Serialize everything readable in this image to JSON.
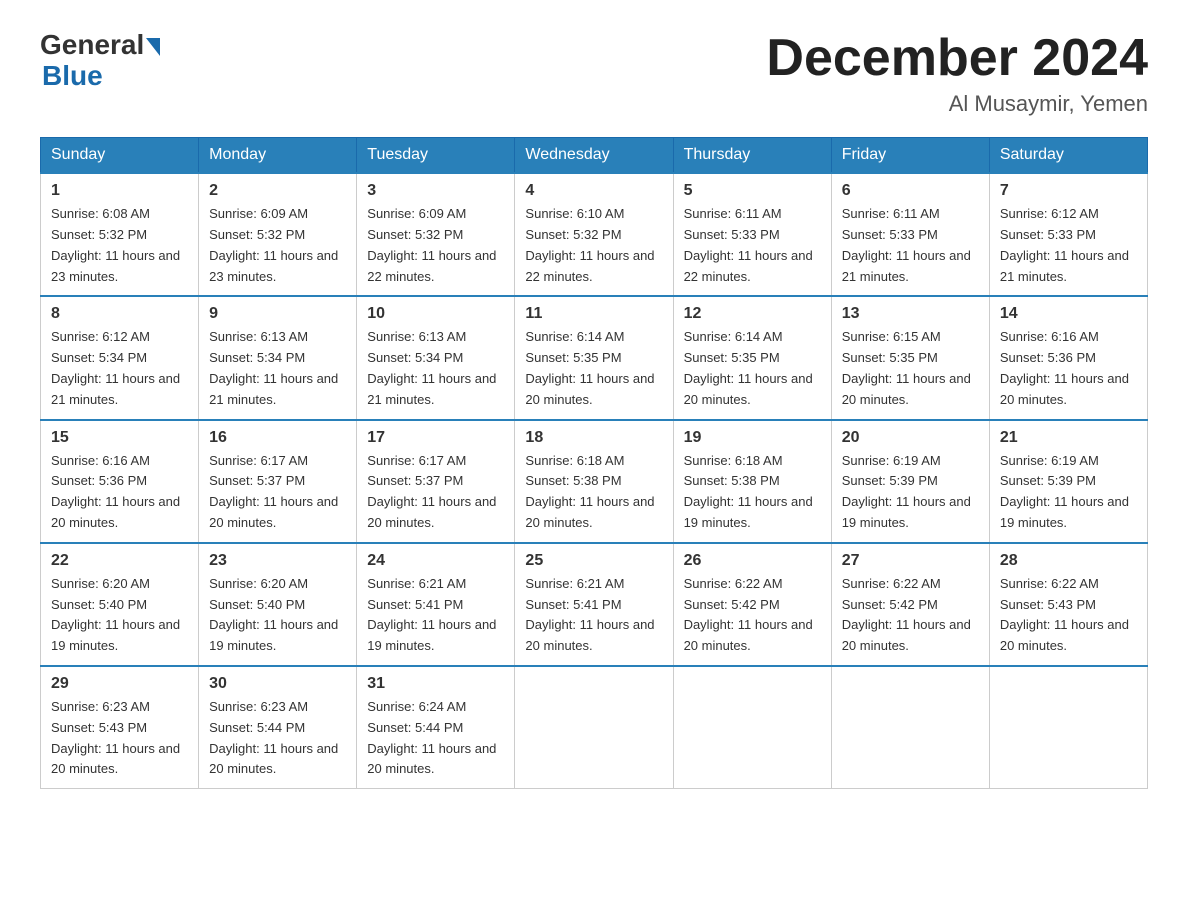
{
  "header": {
    "logo_general": "General",
    "logo_blue": "Blue",
    "month_title": "December 2024",
    "location": "Al Musaymir, Yemen"
  },
  "days_of_week": [
    "Sunday",
    "Monday",
    "Tuesday",
    "Wednesday",
    "Thursday",
    "Friday",
    "Saturday"
  ],
  "weeks": [
    [
      {
        "day": "1",
        "sunrise": "6:08 AM",
        "sunset": "5:32 PM",
        "daylight": "11 hours and 23 minutes."
      },
      {
        "day": "2",
        "sunrise": "6:09 AM",
        "sunset": "5:32 PM",
        "daylight": "11 hours and 23 minutes."
      },
      {
        "day": "3",
        "sunrise": "6:09 AM",
        "sunset": "5:32 PM",
        "daylight": "11 hours and 22 minutes."
      },
      {
        "day": "4",
        "sunrise": "6:10 AM",
        "sunset": "5:32 PM",
        "daylight": "11 hours and 22 minutes."
      },
      {
        "day": "5",
        "sunrise": "6:11 AM",
        "sunset": "5:33 PM",
        "daylight": "11 hours and 22 minutes."
      },
      {
        "day": "6",
        "sunrise": "6:11 AM",
        "sunset": "5:33 PM",
        "daylight": "11 hours and 21 minutes."
      },
      {
        "day": "7",
        "sunrise": "6:12 AM",
        "sunset": "5:33 PM",
        "daylight": "11 hours and 21 minutes."
      }
    ],
    [
      {
        "day": "8",
        "sunrise": "6:12 AM",
        "sunset": "5:34 PM",
        "daylight": "11 hours and 21 minutes."
      },
      {
        "day": "9",
        "sunrise": "6:13 AM",
        "sunset": "5:34 PM",
        "daylight": "11 hours and 21 minutes."
      },
      {
        "day": "10",
        "sunrise": "6:13 AM",
        "sunset": "5:34 PM",
        "daylight": "11 hours and 21 minutes."
      },
      {
        "day": "11",
        "sunrise": "6:14 AM",
        "sunset": "5:35 PM",
        "daylight": "11 hours and 20 minutes."
      },
      {
        "day": "12",
        "sunrise": "6:14 AM",
        "sunset": "5:35 PM",
        "daylight": "11 hours and 20 minutes."
      },
      {
        "day": "13",
        "sunrise": "6:15 AM",
        "sunset": "5:35 PM",
        "daylight": "11 hours and 20 minutes."
      },
      {
        "day": "14",
        "sunrise": "6:16 AM",
        "sunset": "5:36 PM",
        "daylight": "11 hours and 20 minutes."
      }
    ],
    [
      {
        "day": "15",
        "sunrise": "6:16 AM",
        "sunset": "5:36 PM",
        "daylight": "11 hours and 20 minutes."
      },
      {
        "day": "16",
        "sunrise": "6:17 AM",
        "sunset": "5:37 PM",
        "daylight": "11 hours and 20 minutes."
      },
      {
        "day": "17",
        "sunrise": "6:17 AM",
        "sunset": "5:37 PM",
        "daylight": "11 hours and 20 minutes."
      },
      {
        "day": "18",
        "sunrise": "6:18 AM",
        "sunset": "5:38 PM",
        "daylight": "11 hours and 20 minutes."
      },
      {
        "day": "19",
        "sunrise": "6:18 AM",
        "sunset": "5:38 PM",
        "daylight": "11 hours and 19 minutes."
      },
      {
        "day": "20",
        "sunrise": "6:19 AM",
        "sunset": "5:39 PM",
        "daylight": "11 hours and 19 minutes."
      },
      {
        "day": "21",
        "sunrise": "6:19 AM",
        "sunset": "5:39 PM",
        "daylight": "11 hours and 19 minutes."
      }
    ],
    [
      {
        "day": "22",
        "sunrise": "6:20 AM",
        "sunset": "5:40 PM",
        "daylight": "11 hours and 19 minutes."
      },
      {
        "day": "23",
        "sunrise": "6:20 AM",
        "sunset": "5:40 PM",
        "daylight": "11 hours and 19 minutes."
      },
      {
        "day": "24",
        "sunrise": "6:21 AM",
        "sunset": "5:41 PM",
        "daylight": "11 hours and 19 minutes."
      },
      {
        "day": "25",
        "sunrise": "6:21 AM",
        "sunset": "5:41 PM",
        "daylight": "11 hours and 20 minutes."
      },
      {
        "day": "26",
        "sunrise": "6:22 AM",
        "sunset": "5:42 PM",
        "daylight": "11 hours and 20 minutes."
      },
      {
        "day": "27",
        "sunrise": "6:22 AM",
        "sunset": "5:42 PM",
        "daylight": "11 hours and 20 minutes."
      },
      {
        "day": "28",
        "sunrise": "6:22 AM",
        "sunset": "5:43 PM",
        "daylight": "11 hours and 20 minutes."
      }
    ],
    [
      {
        "day": "29",
        "sunrise": "6:23 AM",
        "sunset": "5:43 PM",
        "daylight": "11 hours and 20 minutes."
      },
      {
        "day": "30",
        "sunrise": "6:23 AM",
        "sunset": "5:44 PM",
        "daylight": "11 hours and 20 minutes."
      },
      {
        "day": "31",
        "sunrise": "6:24 AM",
        "sunset": "5:44 PM",
        "daylight": "11 hours and 20 minutes."
      },
      null,
      null,
      null,
      null
    ]
  ]
}
